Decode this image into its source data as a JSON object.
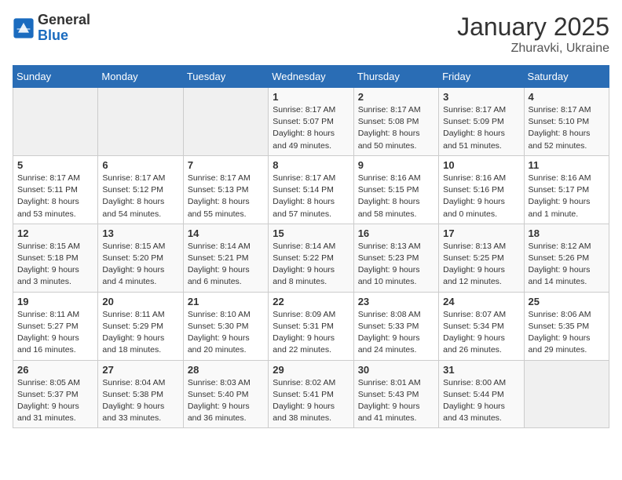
{
  "logo": {
    "general": "General",
    "blue": "Blue"
  },
  "title": "January 2025",
  "subtitle": "Zhuravki, Ukraine",
  "days_of_week": [
    "Sunday",
    "Monday",
    "Tuesday",
    "Wednesday",
    "Thursday",
    "Friday",
    "Saturday"
  ],
  "weeks": [
    [
      {
        "day": "",
        "info": ""
      },
      {
        "day": "",
        "info": ""
      },
      {
        "day": "",
        "info": ""
      },
      {
        "day": "1",
        "info": "Sunrise: 8:17 AM\nSunset: 5:07 PM\nDaylight: 8 hours and 49 minutes."
      },
      {
        "day": "2",
        "info": "Sunrise: 8:17 AM\nSunset: 5:08 PM\nDaylight: 8 hours and 50 minutes."
      },
      {
        "day": "3",
        "info": "Sunrise: 8:17 AM\nSunset: 5:09 PM\nDaylight: 8 hours and 51 minutes."
      },
      {
        "day": "4",
        "info": "Sunrise: 8:17 AM\nSunset: 5:10 PM\nDaylight: 8 hours and 52 minutes."
      }
    ],
    [
      {
        "day": "5",
        "info": "Sunrise: 8:17 AM\nSunset: 5:11 PM\nDaylight: 8 hours and 53 minutes."
      },
      {
        "day": "6",
        "info": "Sunrise: 8:17 AM\nSunset: 5:12 PM\nDaylight: 8 hours and 54 minutes."
      },
      {
        "day": "7",
        "info": "Sunrise: 8:17 AM\nSunset: 5:13 PM\nDaylight: 8 hours and 55 minutes."
      },
      {
        "day": "8",
        "info": "Sunrise: 8:17 AM\nSunset: 5:14 PM\nDaylight: 8 hours and 57 minutes."
      },
      {
        "day": "9",
        "info": "Sunrise: 8:16 AM\nSunset: 5:15 PM\nDaylight: 8 hours and 58 minutes."
      },
      {
        "day": "10",
        "info": "Sunrise: 8:16 AM\nSunset: 5:16 PM\nDaylight: 9 hours and 0 minutes."
      },
      {
        "day": "11",
        "info": "Sunrise: 8:16 AM\nSunset: 5:17 PM\nDaylight: 9 hours and 1 minute."
      }
    ],
    [
      {
        "day": "12",
        "info": "Sunrise: 8:15 AM\nSunset: 5:18 PM\nDaylight: 9 hours and 3 minutes."
      },
      {
        "day": "13",
        "info": "Sunrise: 8:15 AM\nSunset: 5:20 PM\nDaylight: 9 hours and 4 minutes."
      },
      {
        "day": "14",
        "info": "Sunrise: 8:14 AM\nSunset: 5:21 PM\nDaylight: 9 hours and 6 minutes."
      },
      {
        "day": "15",
        "info": "Sunrise: 8:14 AM\nSunset: 5:22 PM\nDaylight: 9 hours and 8 minutes."
      },
      {
        "day": "16",
        "info": "Sunrise: 8:13 AM\nSunset: 5:23 PM\nDaylight: 9 hours and 10 minutes."
      },
      {
        "day": "17",
        "info": "Sunrise: 8:13 AM\nSunset: 5:25 PM\nDaylight: 9 hours and 12 minutes."
      },
      {
        "day": "18",
        "info": "Sunrise: 8:12 AM\nSunset: 5:26 PM\nDaylight: 9 hours and 14 minutes."
      }
    ],
    [
      {
        "day": "19",
        "info": "Sunrise: 8:11 AM\nSunset: 5:27 PM\nDaylight: 9 hours and 16 minutes."
      },
      {
        "day": "20",
        "info": "Sunrise: 8:11 AM\nSunset: 5:29 PM\nDaylight: 9 hours and 18 minutes."
      },
      {
        "day": "21",
        "info": "Sunrise: 8:10 AM\nSunset: 5:30 PM\nDaylight: 9 hours and 20 minutes."
      },
      {
        "day": "22",
        "info": "Sunrise: 8:09 AM\nSunset: 5:31 PM\nDaylight: 9 hours and 22 minutes."
      },
      {
        "day": "23",
        "info": "Sunrise: 8:08 AM\nSunset: 5:33 PM\nDaylight: 9 hours and 24 minutes."
      },
      {
        "day": "24",
        "info": "Sunrise: 8:07 AM\nSunset: 5:34 PM\nDaylight: 9 hours and 26 minutes."
      },
      {
        "day": "25",
        "info": "Sunrise: 8:06 AM\nSunset: 5:35 PM\nDaylight: 9 hours and 29 minutes."
      }
    ],
    [
      {
        "day": "26",
        "info": "Sunrise: 8:05 AM\nSunset: 5:37 PM\nDaylight: 9 hours and 31 minutes."
      },
      {
        "day": "27",
        "info": "Sunrise: 8:04 AM\nSunset: 5:38 PM\nDaylight: 9 hours and 33 minutes."
      },
      {
        "day": "28",
        "info": "Sunrise: 8:03 AM\nSunset: 5:40 PM\nDaylight: 9 hours and 36 minutes."
      },
      {
        "day": "29",
        "info": "Sunrise: 8:02 AM\nSunset: 5:41 PM\nDaylight: 9 hours and 38 minutes."
      },
      {
        "day": "30",
        "info": "Sunrise: 8:01 AM\nSunset: 5:43 PM\nDaylight: 9 hours and 41 minutes."
      },
      {
        "day": "31",
        "info": "Sunrise: 8:00 AM\nSunset: 5:44 PM\nDaylight: 9 hours and 43 minutes."
      },
      {
        "day": "",
        "info": ""
      }
    ]
  ]
}
